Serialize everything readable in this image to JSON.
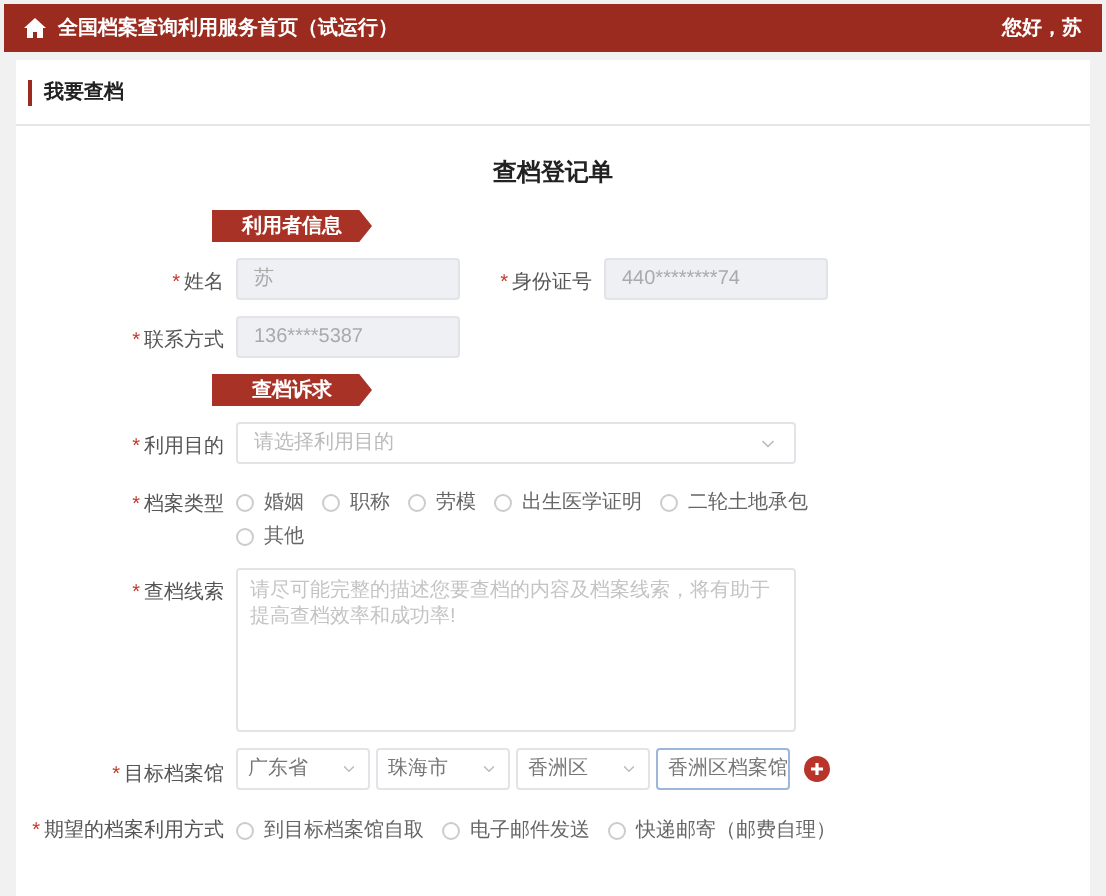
{
  "header": {
    "title": "全国档案查询利用服务首页（试运行）",
    "greeting": "您好，苏"
  },
  "page_title": "我要查档",
  "form_title": "查档登记单",
  "sections": [
    {
      "title": "利用者信息",
      "rows": [
        {
          "fields": [
            {
              "kind": "text",
              "label": "姓名",
              "required_mark": "*",
              "value": "苏"
            },
            {
              "kind": "text",
              "label": "身份证号",
              "required_mark": "*",
              "value": "440********74"
            }
          ]
        },
        {
          "fields": [
            {
              "kind": "text",
              "label": "联系方式",
              "required_mark": "*",
              "value": "136****5387"
            }
          ]
        }
      ]
    },
    {
      "title": "查档诉求",
      "rows": [
        {
          "fields": [
            {
              "kind": "select",
              "label": "利用目的",
              "required_mark": "*",
              "placeholder": "请选择利用目的"
            }
          ]
        },
        {
          "fields": [
            {
              "kind": "radio",
              "label": "档案类型",
              "required_mark": "*",
              "options": [
                {
                  "label": "婚姻",
                  "selected": false
                },
                {
                  "label": "职称",
                  "selected": false
                },
                {
                  "label": "劳模",
                  "selected": false
                },
                {
                  "label": "出生医学证明",
                  "selected": false
                },
                {
                  "label": "二轮土地承包",
                  "selected": false
                },
                {
                  "label": "其他",
                  "selected": false
                }
              ]
            }
          ]
        },
        {
          "fields": [
            {
              "kind": "textarea",
              "label": "查档线索",
              "required_mark": "*",
              "placeholder": "请尽可能完整的描述您要查档的内容及档案线索，将有助于提高查档效率和成功率!"
            }
          ]
        },
        {
          "fields": [
            {
              "kind": "cascade",
              "label": "目标档案馆",
              "required_mark": "*",
              "values": [
                "广东省",
                "珠海市",
                "香洲区",
                "香洲区档案馆"
              ]
            }
          ]
        },
        {
          "fields": [
            {
              "kind": "radio",
              "label": "期望的档案利用方式",
              "required_mark": "*",
              "options": [
                {
                  "label": "到目标档案馆自取",
                  "selected": false
                },
                {
                  "label": "电子邮件发送",
                  "selected": false
                },
                {
                  "label": "快递邮寄（邮费自理）",
                  "selected": false
                }
              ]
            }
          ]
        }
      ]
    }
  ]
}
